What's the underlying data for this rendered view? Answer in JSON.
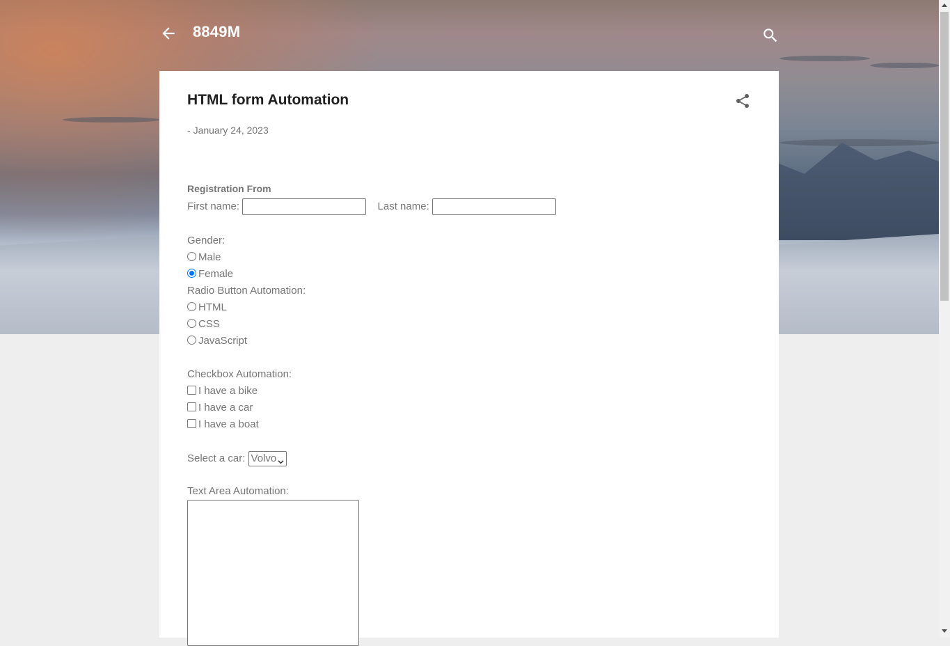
{
  "header": {
    "site_title": "8849M",
    "back_icon": "arrow-left-icon",
    "search_icon": "search-icon"
  },
  "post": {
    "title": "HTML form Automation",
    "date_prefix": "- ",
    "date": "January 24, 2023",
    "share_icon": "share-icon"
  },
  "form": {
    "heading": "Registration From",
    "first_name_label": "First name:",
    "first_name_value": "",
    "last_name_label": "Last name:",
    "last_name_value": "",
    "gender_label": "Gender:",
    "gender_options": [
      {
        "label": "Male",
        "checked": false
      },
      {
        "label": "Female",
        "checked": true
      }
    ],
    "radio_label": "Radio Button Automation:",
    "radio_options": [
      {
        "label": "HTML",
        "checked": false
      },
      {
        "label": "CSS",
        "checked": false
      },
      {
        "label": "JavaScript",
        "checked": false
      }
    ],
    "checkbox_label": "Checkbox Automation:",
    "checkbox_options": [
      {
        "label": "I have a bike",
        "checked": false
      },
      {
        "label": "I have a car",
        "checked": false
      },
      {
        "label": "I have a boat",
        "checked": false
      }
    ],
    "select_label": "Select a car:",
    "select_value": "Volvo",
    "textarea_label": "Text Area Automation:",
    "textarea_value": ""
  },
  "colors": {
    "card_bg": "#ffffff",
    "page_bg": "#eeeeee",
    "text_muted": "#757575",
    "title_text": "#212121",
    "radio_checked": "#0075ff"
  }
}
